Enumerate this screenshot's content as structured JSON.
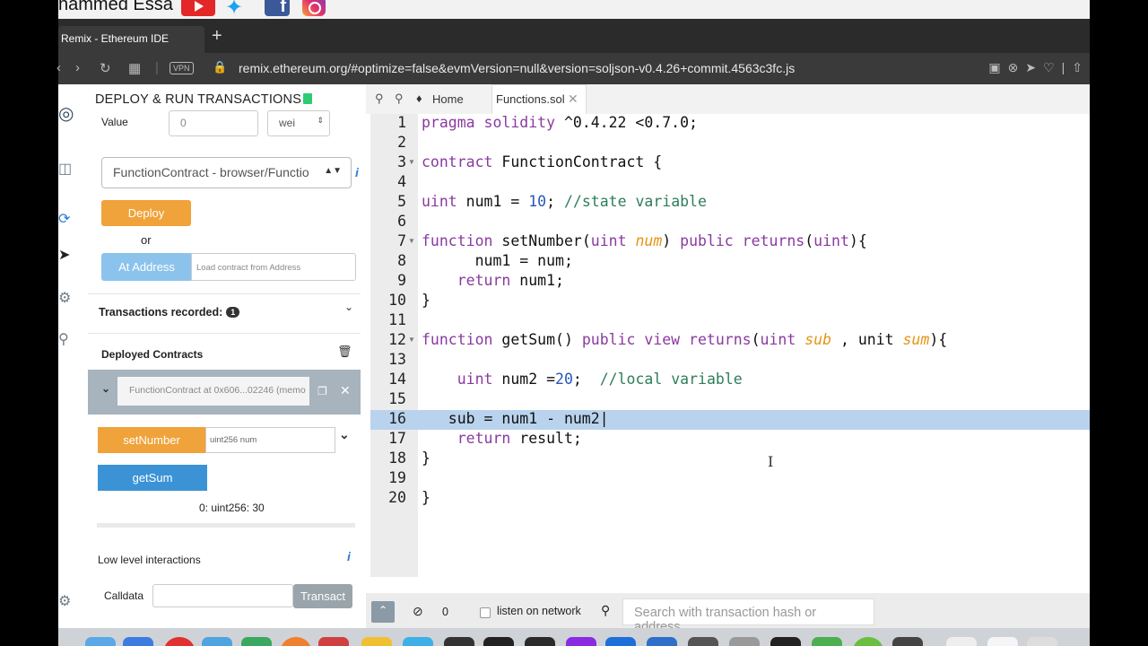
{
  "banner": {
    "name": "hammed Essa"
  },
  "browser": {
    "tab_title": "Remix - Ethereum IDE",
    "new_tab": "+",
    "vpn": "VPN",
    "url": "remix.ethereum.org/#optimize=false&evmVersion=null&version=soljson-v0.4.26+commit.4563c3fc.js"
  },
  "panel": {
    "title": "DEPLOY & RUN TRANSACTIONS",
    "value_label": "Value",
    "value": "0",
    "unit": "wei",
    "contract_select": "FunctionContract - browser/Functio",
    "deploy": "Deploy",
    "or": "or",
    "at_address": "At Address",
    "at_address_placeholder": "Load contract from Address",
    "transactions_recorded": "Transactions recorded:",
    "transactions_count": "1",
    "deployed_contracts": "Deployed Contracts",
    "contract_instance": "FunctionContract at 0x606...02246 (memo",
    "set_number": "setNumber",
    "set_number_param": "uint256 num",
    "get_sum": "getSum",
    "result": "0: uint256: 30",
    "low_level": "Low level interactions",
    "calldata": "Calldata",
    "transact": "Transact"
  },
  "editor": {
    "home_tab": "Home",
    "file_tab": "Functions.sol",
    "line_numbers": [
      "1",
      "2",
      "3",
      "4",
      "5",
      "6",
      "7",
      "8",
      "9",
      "10",
      "11",
      "12",
      "13",
      "14",
      "15",
      "16",
      "17",
      "18",
      "19",
      "20"
    ]
  },
  "terminal": {
    "count": "0",
    "listen": "listen on network",
    "search_placeholder": "Search with transaction hash or address"
  }
}
